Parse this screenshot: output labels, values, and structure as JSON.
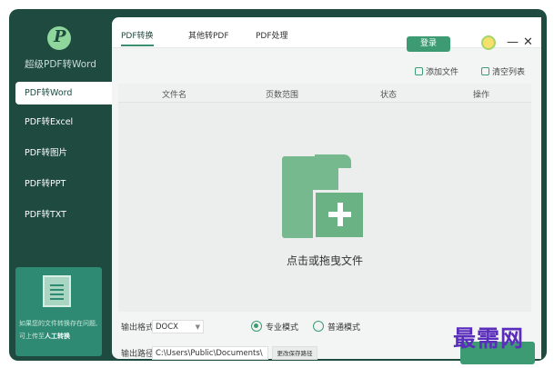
{
  "sidebar": {
    "app_title": "超级PDF转Word",
    "items": [
      {
        "label": "PDF转Word"
      },
      {
        "label": "PDF转Excel"
      },
      {
        "label": "PDF转图片"
      },
      {
        "label": "PDF转PPT"
      },
      {
        "label": "PDF转TXT"
      }
    ],
    "promo": {
      "text": "如果您的文件转换存在问题,可上传至",
      "link": "人工转换"
    }
  },
  "header": {
    "tabs": [
      {
        "label": "PDF转换"
      },
      {
        "label": "其他转PDF"
      },
      {
        "label": "PDF处理"
      }
    ],
    "login_label": "登录",
    "minimize_label": "—",
    "close_label": "✕"
  },
  "toolbar": {
    "add_file_label": "添加文件",
    "clear_list_label": "清空列表"
  },
  "table": {
    "columns": [
      "文件名",
      "页数范围",
      "状态",
      "操作"
    ]
  },
  "dropzone": {
    "text": "点击或拖曳文件"
  },
  "output": {
    "format_label": "输出格式:",
    "format_value": "DOCX",
    "mode_pro_label": "专业模式",
    "mode_normal_label": "普通模式",
    "path_label": "输出路径:",
    "path_value": "C:\\Users\\Public\\Documents\\",
    "change_path_label": "更改保存路径"
  },
  "watermark": "最需网",
  "colors": {
    "sidebar_bg": "#1e4a40",
    "accent": "#3d9b73",
    "folder": "#76b98f"
  }
}
